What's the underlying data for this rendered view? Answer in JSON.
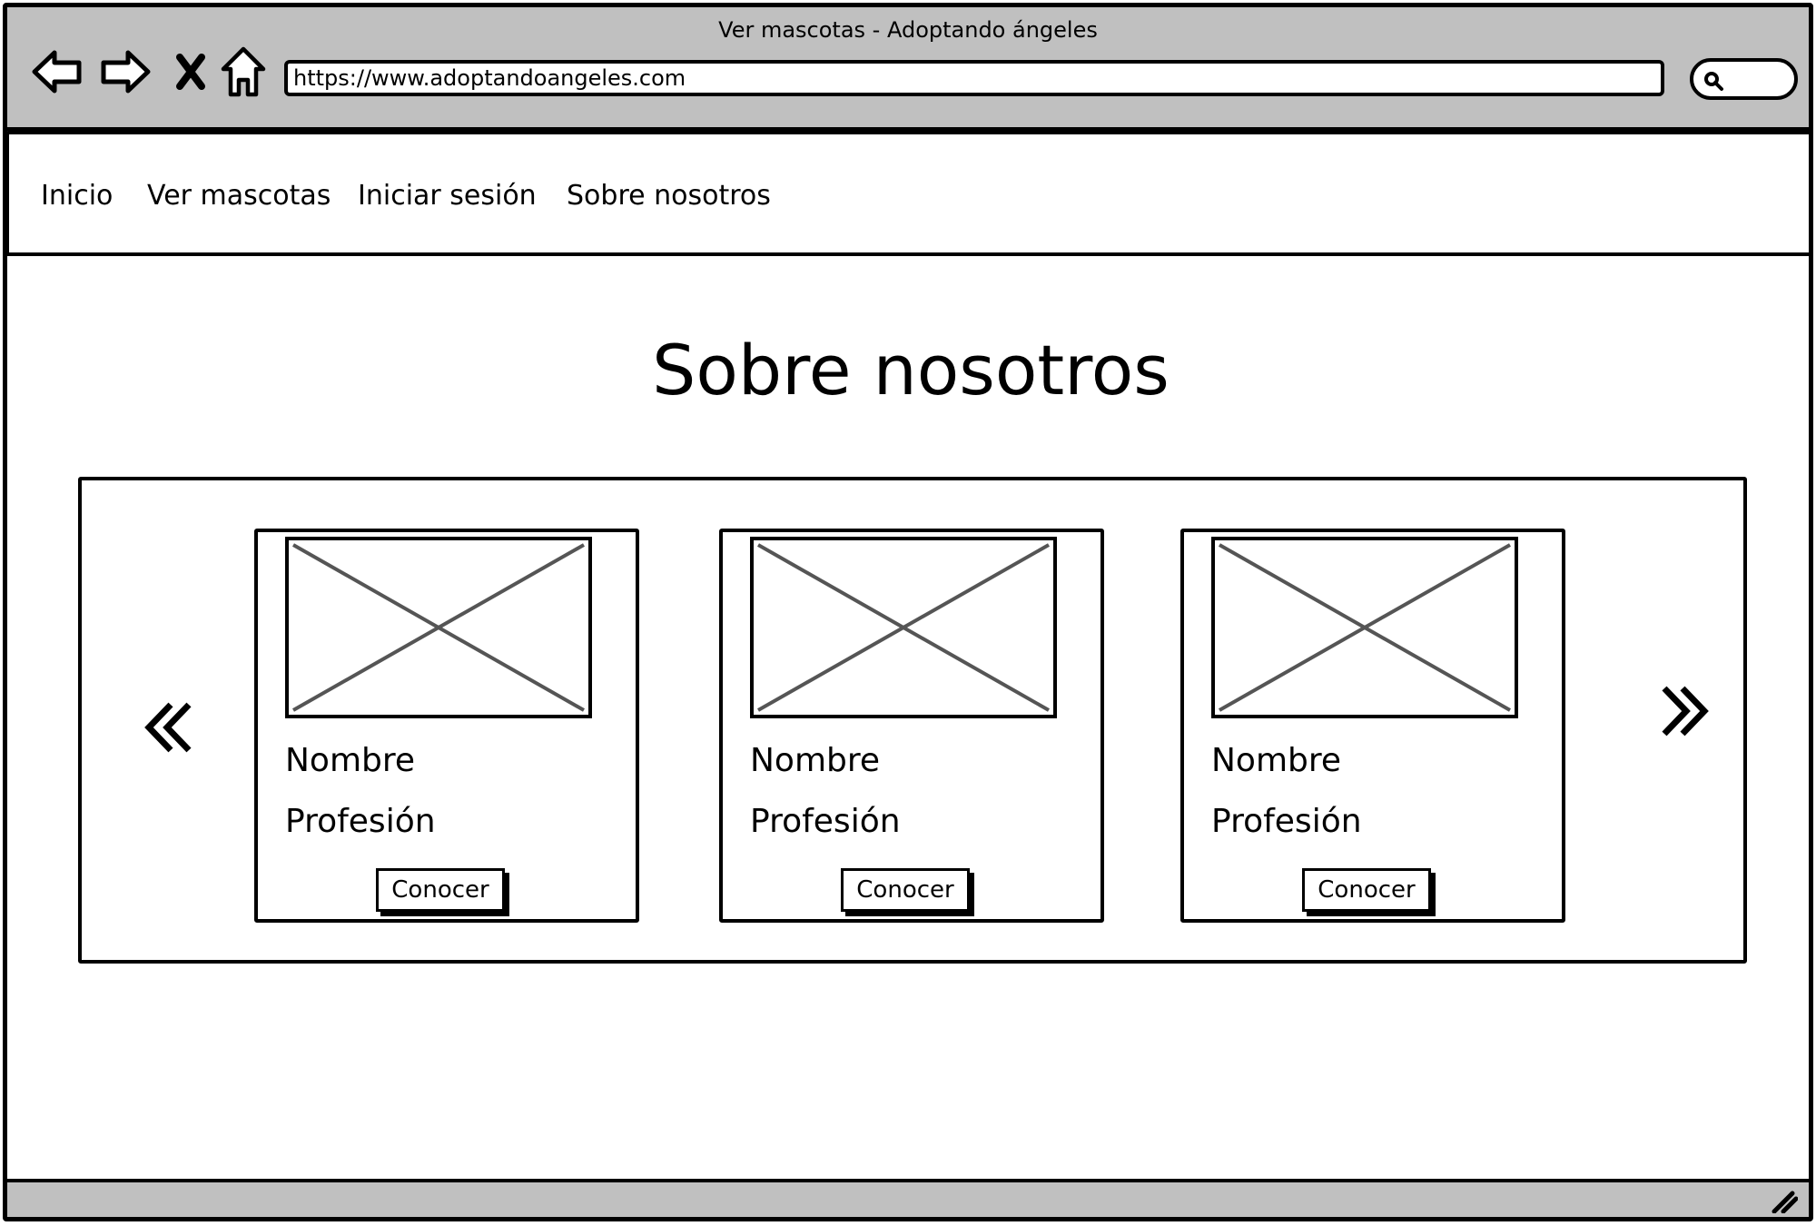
{
  "browser": {
    "window_title": "Ver mascotas - Adoptando ángeles",
    "url": "https://www.adoptandoangeles.com",
    "icons": {
      "back": "back-arrow-icon",
      "forward": "forward-arrow-icon",
      "stop": "close-x-icon",
      "home": "home-icon",
      "search": "search-icon"
    },
    "chrome_color": "#c0c0c0"
  },
  "nav": {
    "links": [
      {
        "label": "Inicio"
      },
      {
        "label": "Ver mascotas"
      },
      {
        "label": "Iniciar sesión"
      },
      {
        "label": "Sobre nosotros"
      }
    ]
  },
  "page": {
    "title": "Sobre nosotros"
  },
  "carousel": {
    "prev_icon": "double-chevron-left-icon",
    "next_icon": "double-chevron-right-icon",
    "cards": [
      {
        "name": "Nombre",
        "profession": "Profesión",
        "button_label": "Conocer",
        "image": "image-placeholder"
      },
      {
        "name": "Nombre",
        "profession": "Profesión",
        "button_label": "Conocer",
        "image": "image-placeholder"
      },
      {
        "name": "Nombre",
        "profession": "Profesión",
        "button_label": "Conocer",
        "image": "image-placeholder"
      }
    ]
  }
}
